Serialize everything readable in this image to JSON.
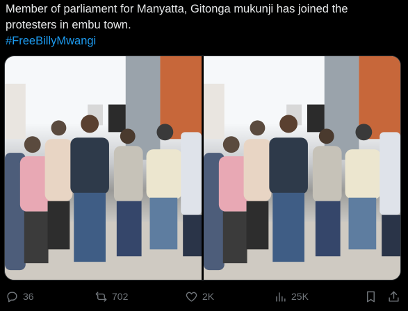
{
  "tweet": {
    "text": "Member of parliament for Manyatta, Gitonga mukunji has joined the protesters in embu town.",
    "hashtag": "#FreeBillyMwangi"
  },
  "colors": {
    "background": "#000000",
    "text": "#e7e9ea",
    "muted": "#71767b",
    "link": "#1d9bf0"
  },
  "media": {
    "photos": [
      {
        "icon": "crowd-photo"
      },
      {
        "icon": "crowd-photo"
      }
    ]
  },
  "actions": {
    "replies": "36",
    "reposts": "702",
    "likes": "2K",
    "views": "25K"
  }
}
